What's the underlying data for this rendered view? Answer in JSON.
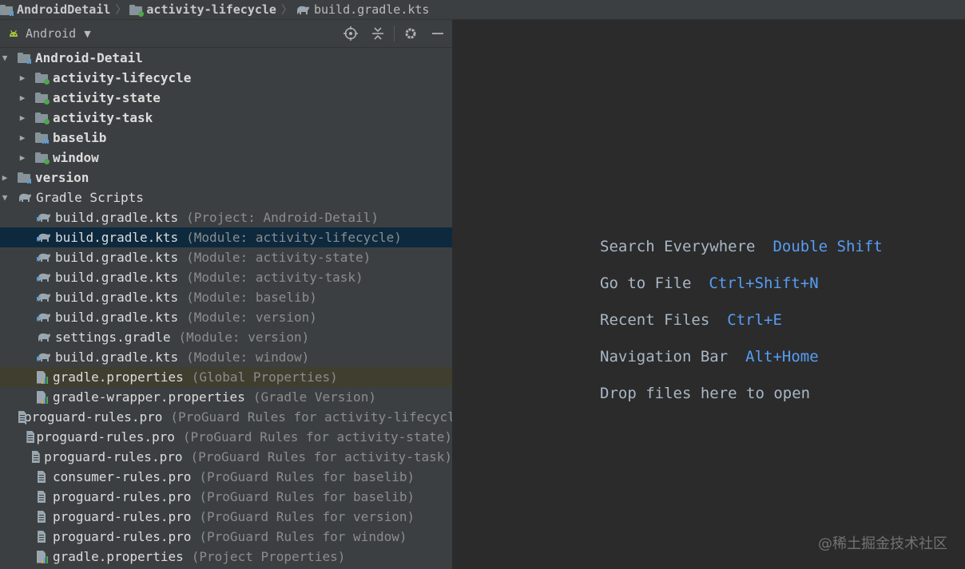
{
  "breadcrumb": [
    {
      "label": "AndroidDetail",
      "icon": "module-folder-icon"
    },
    {
      "label": "activity-lifecycle",
      "icon": "module-folder-icon"
    },
    {
      "label": "build.gradle.kts",
      "icon": "gradle-elephant-icon"
    }
  ],
  "panel": {
    "view_label": "Android",
    "tools": [
      "locate-icon",
      "collapse-all-icon",
      "gear-icon",
      "hide-icon"
    ]
  },
  "tree": [
    {
      "name": "Android-Detail",
      "hint": "",
      "arrow": "▼",
      "indent": 0,
      "icon": "module-folder",
      "bold": true
    },
    {
      "name": "activity-lifecycle",
      "hint": "",
      "arrow": "▶",
      "indent": 1,
      "icon": "app-module-folder",
      "bold": true
    },
    {
      "name": "activity-state",
      "hint": "",
      "arrow": "▶",
      "indent": 1,
      "icon": "app-module-folder",
      "bold": true
    },
    {
      "name": "activity-task",
      "hint": "",
      "arrow": "▶",
      "indent": 1,
      "icon": "app-module-folder",
      "bold": true
    },
    {
      "name": "baselib",
      "hint": "",
      "arrow": "▶",
      "indent": 1,
      "icon": "lib-module-folder",
      "bold": true
    },
    {
      "name": "window",
      "hint": "",
      "arrow": "▶",
      "indent": 1,
      "icon": "app-module-folder",
      "bold": true
    },
    {
      "name": "version",
      "hint": "",
      "arrow": "▶",
      "indent": 0,
      "icon": "module-folder",
      "bold": true
    },
    {
      "name": "Gradle Scripts",
      "hint": "",
      "arrow": "▼",
      "indent": 0,
      "icon": "gradle",
      "bold": false
    },
    {
      "name": "build.gradle.kts",
      "hint": "(Project: Android-Detail)",
      "arrow": "",
      "indent": 1,
      "icon": "gradle-kts",
      "bold": false
    },
    {
      "name": "build.gradle.kts",
      "hint": "(Module: activity-lifecycle)",
      "arrow": "",
      "indent": 1,
      "icon": "gradle-kts",
      "bold": false,
      "state": "selected"
    },
    {
      "name": "build.gradle.kts",
      "hint": "(Module: activity-state)",
      "arrow": "",
      "indent": 1,
      "icon": "gradle-kts",
      "bold": false
    },
    {
      "name": "build.gradle.kts",
      "hint": "(Module: activity-task)",
      "arrow": "",
      "indent": 1,
      "icon": "gradle-kts",
      "bold": false
    },
    {
      "name": "build.gradle.kts",
      "hint": "(Module: baselib)",
      "arrow": "",
      "indent": 1,
      "icon": "gradle-kts",
      "bold": false
    },
    {
      "name": "build.gradle.kts",
      "hint": "(Module: version)",
      "arrow": "",
      "indent": 1,
      "icon": "gradle-kts",
      "bold": false
    },
    {
      "name": "settings.gradle",
      "hint": "(Module: version)",
      "arrow": "",
      "indent": 1,
      "icon": "gradle",
      "bold": false
    },
    {
      "name": "build.gradle.kts",
      "hint": "(Module: window)",
      "arrow": "",
      "indent": 1,
      "icon": "gradle-kts",
      "bold": false
    },
    {
      "name": "gradle.properties",
      "hint": "(Global Properties)",
      "arrow": "",
      "indent": 1,
      "icon": "properties",
      "bold": false,
      "state": "highlighted"
    },
    {
      "name": "gradle-wrapper.properties",
      "hint": "(Gradle Version)",
      "arrow": "",
      "indent": 1,
      "icon": "properties",
      "bold": false
    },
    {
      "name": "proguard-rules.pro",
      "hint": "(ProGuard Rules for activity-lifecycle)",
      "arrow": "",
      "indent": 1,
      "icon": "text-file",
      "bold": false
    },
    {
      "name": "proguard-rules.pro",
      "hint": "(ProGuard Rules for activity-state)",
      "arrow": "",
      "indent": 1,
      "icon": "text-file",
      "bold": false
    },
    {
      "name": "proguard-rules.pro",
      "hint": "(ProGuard Rules for activity-task)",
      "arrow": "",
      "indent": 1,
      "icon": "text-file",
      "bold": false
    },
    {
      "name": "consumer-rules.pro",
      "hint": "(ProGuard Rules for baselib)",
      "arrow": "",
      "indent": 1,
      "icon": "text-file",
      "bold": false
    },
    {
      "name": "proguard-rules.pro",
      "hint": "(ProGuard Rules for baselib)",
      "arrow": "",
      "indent": 1,
      "icon": "text-file",
      "bold": false
    },
    {
      "name": "proguard-rules.pro",
      "hint": "(ProGuard Rules for version)",
      "arrow": "",
      "indent": 1,
      "icon": "text-file",
      "bold": false
    },
    {
      "name": "proguard-rules.pro",
      "hint": "(ProGuard Rules for window)",
      "arrow": "",
      "indent": 1,
      "icon": "text-file",
      "bold": false
    },
    {
      "name": "gradle.properties",
      "hint": "(Project Properties)",
      "arrow": "",
      "indent": 1,
      "icon": "properties",
      "bold": false
    }
  ],
  "editor": {
    "tips": [
      {
        "action": "Search Everywhere",
        "shortcut": "Double Shift"
      },
      {
        "action": "Go to File",
        "shortcut": "Ctrl+Shift+N"
      },
      {
        "action": "Recent Files",
        "shortcut": "Ctrl+E"
      },
      {
        "action": "Navigation Bar",
        "shortcut": "Alt+Home"
      },
      {
        "action": "Drop files here to open",
        "shortcut": ""
      }
    ],
    "watermark": "@稀土掘金技术社区"
  },
  "colors": {
    "panel_bg": "#3c3f41",
    "editor_bg": "#2b2b2b",
    "selection": "#0d293e",
    "highlight": "#3f3e2f",
    "shortcut": "#589df6",
    "android_green": "#a4c639"
  }
}
